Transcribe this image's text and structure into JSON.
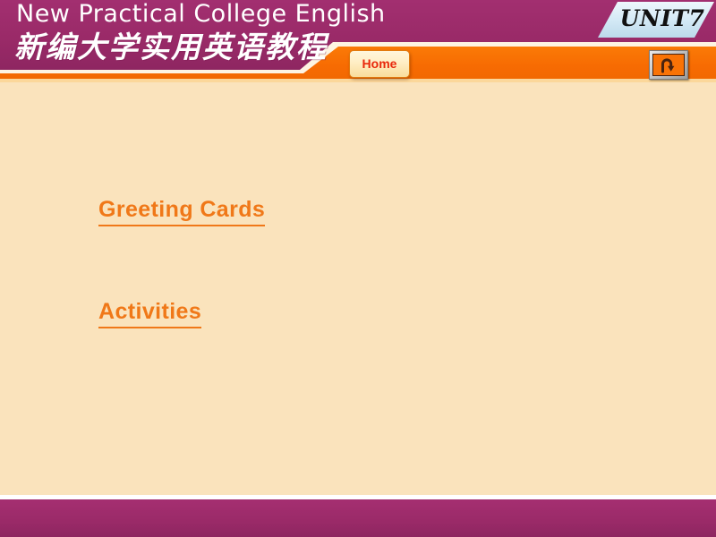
{
  "header": {
    "title_en": "New Practical College English",
    "title_cn": "新编大学实用英语教程",
    "unit_badge": "UNIT7",
    "home_button": "Home",
    "return_button_icon": "u-turn-arrow-icon",
    "colors": {
      "banner_purple": "#9c2b6b",
      "toolbar_orange": "#f97306",
      "badge_blue": "#d9edf8",
      "home_text_red": "#e8280c"
    }
  },
  "main": {
    "links": [
      {
        "label": "Greeting Cards"
      },
      {
        "label": "Activities"
      }
    ]
  },
  "footer": {
    "bar_color": "#9c2b6b"
  }
}
